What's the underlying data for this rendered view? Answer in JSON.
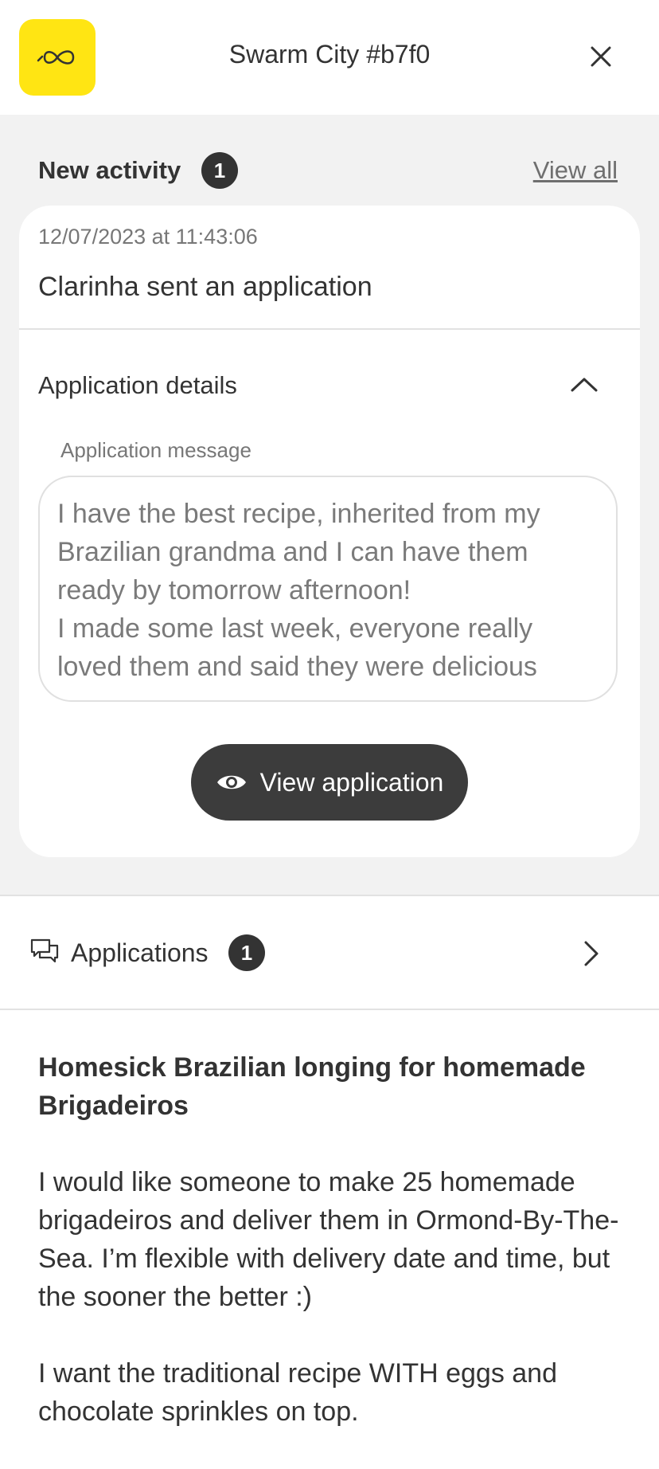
{
  "header": {
    "title": "Swarm City #b7f0",
    "logo_icon": "infinity-icon",
    "close_icon": "close-icon",
    "logo_color": "#ffe513"
  },
  "activity": {
    "title": "New activity",
    "count": "1",
    "view_all_label": "View all",
    "card": {
      "timestamp": "12/07/2023 at 11:43:06",
      "notification": "Clarinha sent an application",
      "details_label": "Application details",
      "details_toggle_icon": "chevron-up-icon",
      "message_label": "Application message",
      "message": "I have the best recipe, inherited from my Brazilian grandma and I can have them ready by tomorrow afternoon!\nI made some last week, everyone really loved them and said they were delicious",
      "view_button_label": "View application",
      "view_button_icon": "eye-icon"
    }
  },
  "applications": {
    "label": "Applications",
    "count": "1",
    "icon": "chat-bubbles-icon",
    "chevron_icon": "chevron-right-icon"
  },
  "request": {
    "title": "Homesick Brazilian longing for homemade Brigadeiros",
    "paragraphs": [
      "I would like someone to make 25 homemade brigadeiros and deliver them in Ormond-By-The-Sea. I’m flexible with delivery date and time, but the sooner the better :)",
      "I want the traditional recipe WITH eggs and chocolate sprinkles on top."
    ]
  },
  "colors": {
    "accent_yellow": "#ffe513",
    "dark": "#333333",
    "background_gray": "#f2f2f2"
  }
}
